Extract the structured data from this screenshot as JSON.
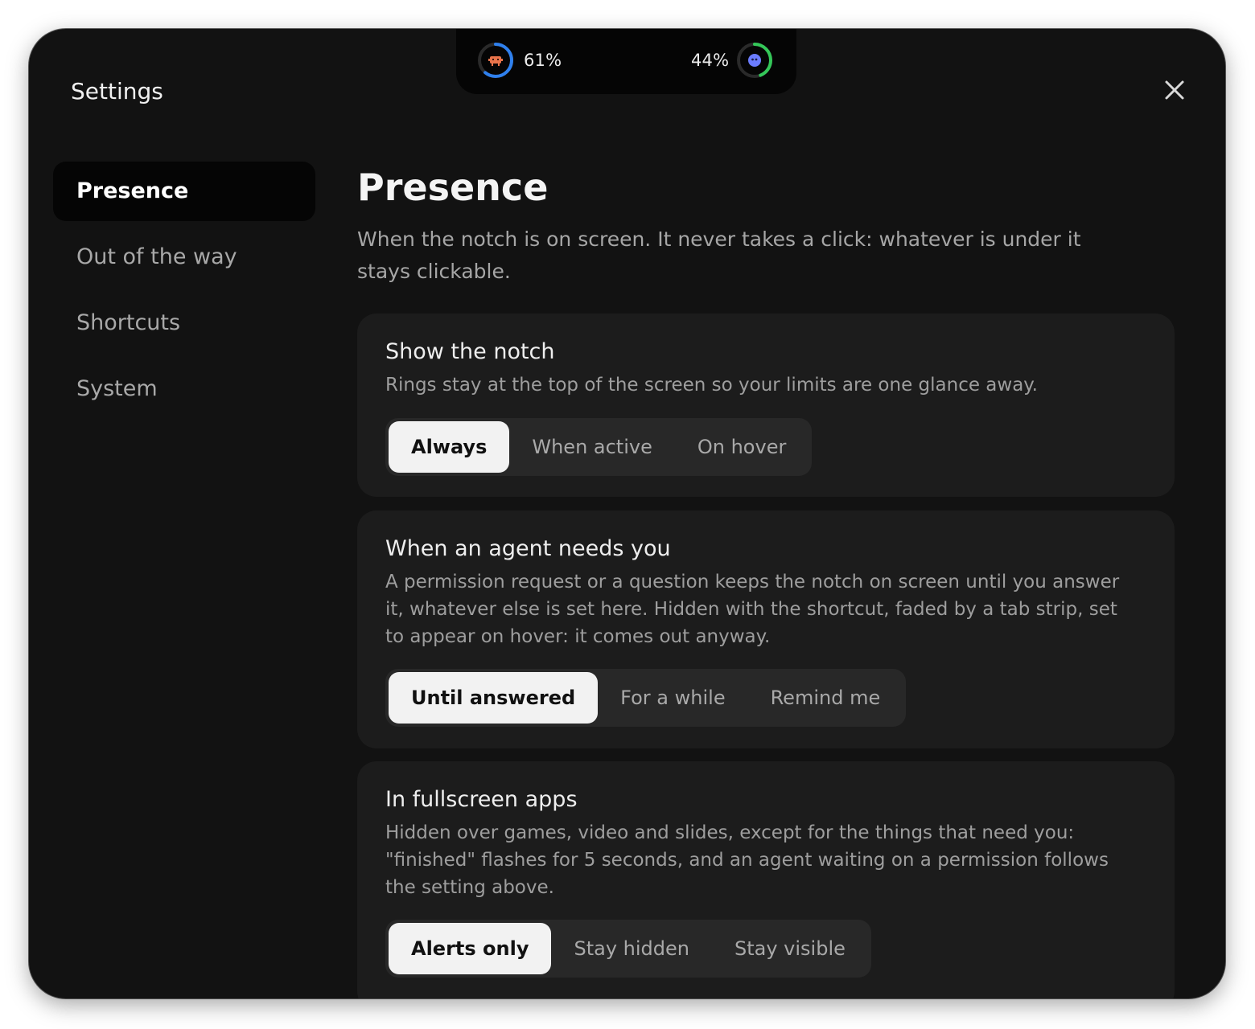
{
  "window": {
    "title": "Settings"
  },
  "notch": {
    "left_ring": {
      "percent_label": "61%",
      "value": 61,
      "color": "#2f80ed",
      "glyph": "robot-icon",
      "glyph_color": "#e8734a"
    },
    "right_ring": {
      "percent_label": "44%",
      "value": 44,
      "color": "#34c759",
      "glyph": "blob-icon",
      "glyph_color": "#6b7cff"
    }
  },
  "sidebar": {
    "items": [
      {
        "label": "Presence",
        "active": true
      },
      {
        "label": "Out of the way",
        "active": false
      },
      {
        "label": "Shortcuts",
        "active": false
      },
      {
        "label": "System",
        "active": false
      }
    ]
  },
  "main": {
    "title": "Presence",
    "description": "When the notch is on screen. It never takes a click: whatever is under it stays clickable.",
    "cards": [
      {
        "title": "Show the notch",
        "description": "Rings stay at the top of the screen so your limits are one glance away.",
        "options": [
          "Always",
          "When active",
          "On hover"
        ],
        "selected": "Always"
      },
      {
        "title": "When an agent needs you",
        "description": "A permission request or a question keeps the notch on screen until you answer it, whatever else is set here. Hidden with the shortcut, faded by a tab strip, set to appear on hover: it comes out anyway.",
        "options": [
          "Until answered",
          "For a while",
          "Remind me"
        ],
        "selected": "Until answered"
      },
      {
        "title": "In fullscreen apps",
        "description": "Hidden over games, video and slides, except for the things that need you: \"finished\" flashes for 5 seconds, and an agent waiting on a permission follows the setting above.",
        "options": [
          "Alerts only",
          "Stay hidden",
          "Stay visible"
        ],
        "selected": "Alerts only"
      }
    ]
  },
  "colors": {
    "window_bg": "#121212",
    "card_bg": "#1c1c1c",
    "segment_bg": "#282828",
    "selected_bg": "#f2f2f2"
  }
}
